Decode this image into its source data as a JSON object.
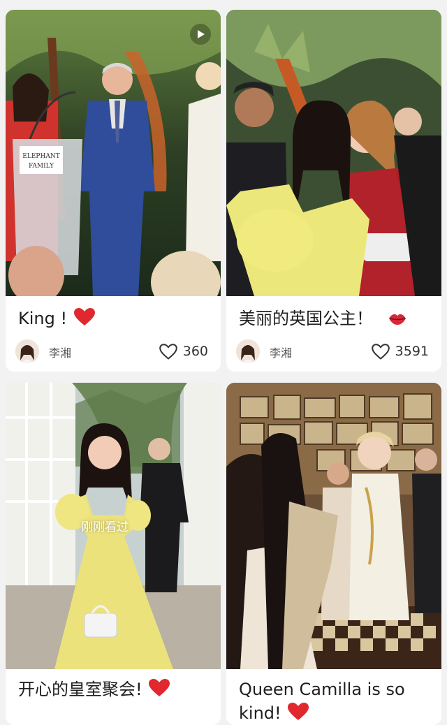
{
  "feed": {
    "cards": [
      {
        "title": "King !",
        "title_emoji": "heart-emoji",
        "author": "李湘",
        "likes": "360",
        "has_video": true
      },
      {
        "title": "美丽的英国公主！",
        "title_emoji": "kiss-lips-emoji",
        "author": "李湘",
        "likes": "3591",
        "has_video": false
      },
      {
        "title": "开心的皇室聚会!",
        "title_emoji": "heart-emoji",
        "viewed_badge": "刚刚看过",
        "has_video": false
      },
      {
        "title_line1": "Queen Camilla is so",
        "title_line2": "kind!",
        "title_emoji": "heart-emoji",
        "has_video": false
      }
    ]
  },
  "colors": {
    "heart_red": "#e0282e",
    "background": "#f2f2f2",
    "card": "#ffffff"
  }
}
